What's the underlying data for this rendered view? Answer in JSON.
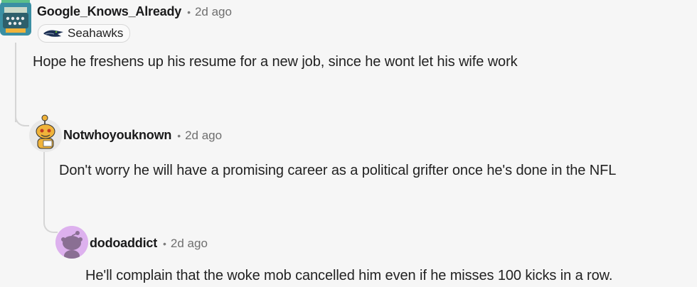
{
  "comments": [
    {
      "username": "Google_Knows_Already",
      "time": "2d ago",
      "flair": "Seahawks",
      "flair_icon": "seahawks-logo-icon",
      "body": "Hope he freshens up his resume for a new job, since he wont let his wife work",
      "avatar_icon": "snoo-avatar-typewriter-icon"
    },
    {
      "username": "Notwhoyouknown",
      "time": "2d ago",
      "body": "Don't worry he will have a promising career as a political grifter once he's done in the NFL",
      "avatar_icon": "snoo-avatar-orange-icon"
    },
    {
      "username": "dodoaddict",
      "time": "2d ago",
      "body": "He'll complain that the woke mob cancelled him even if he misses 100 kicks in a row.",
      "avatar_icon": "snoo-avatar-default-icon"
    }
  ],
  "separator": "•",
  "colors": {
    "background": "#f6f6f6",
    "thread_line": "#d5d5d5",
    "default_avatar_bg": "#ddb1ee",
    "default_avatar_fg": "#8a6f93"
  }
}
